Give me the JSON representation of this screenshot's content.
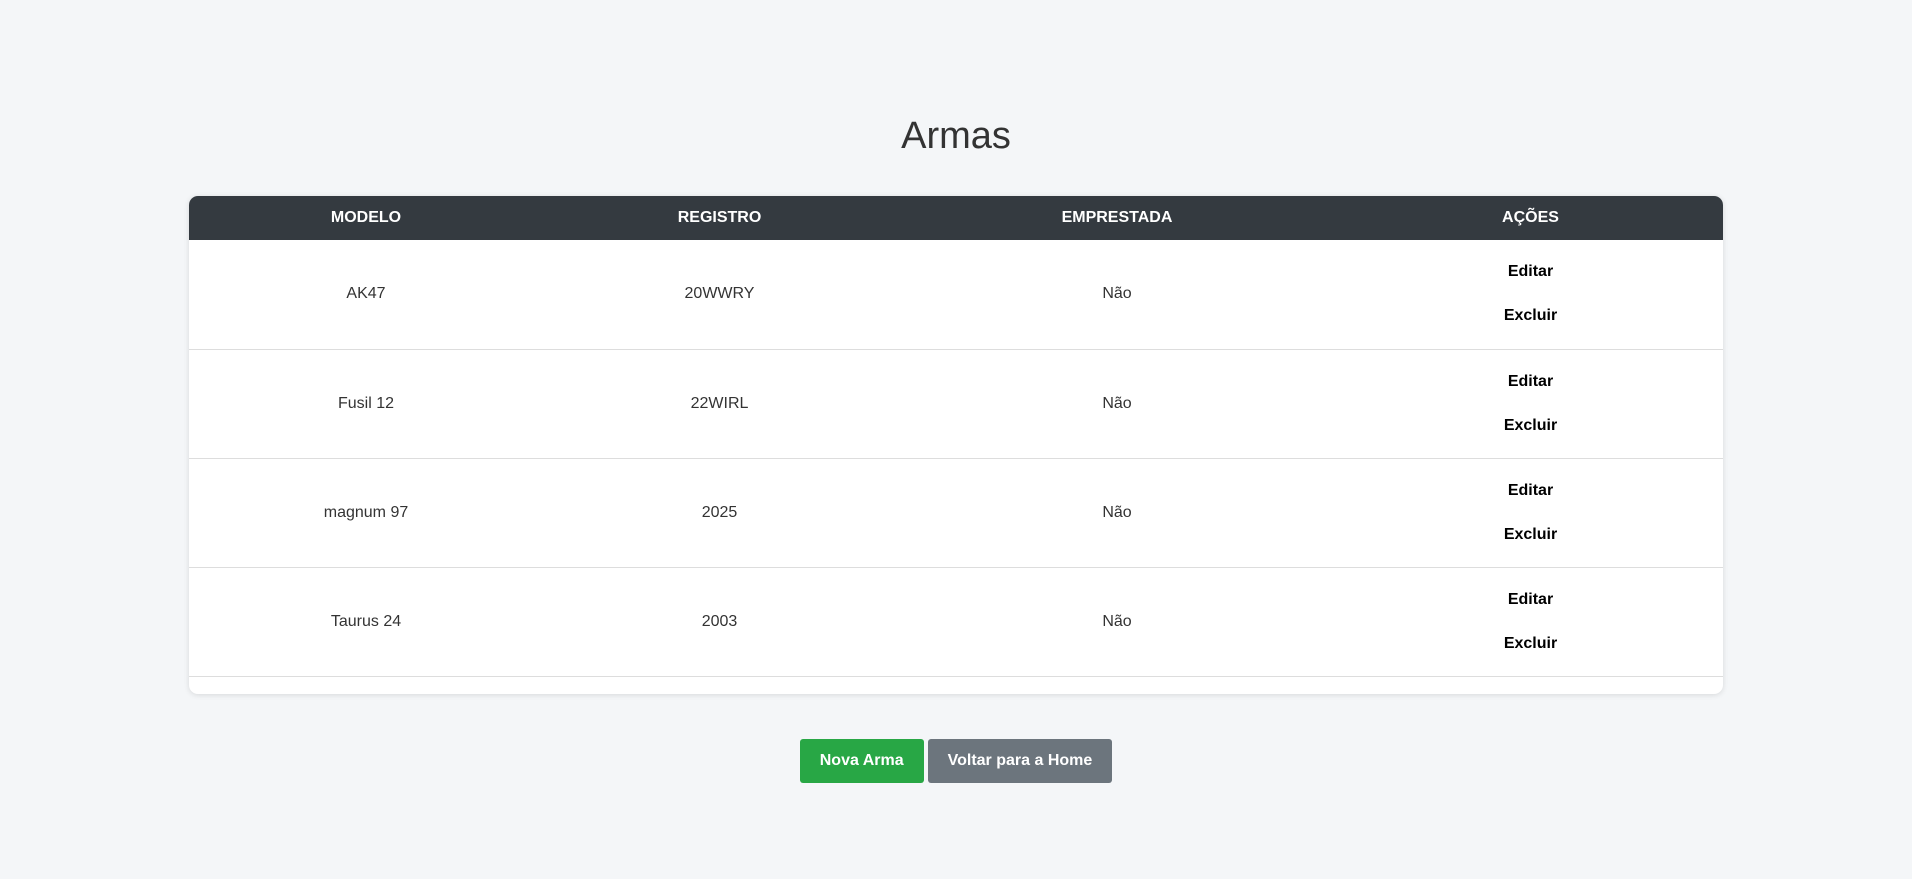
{
  "page": {
    "title": "Armas"
  },
  "table": {
    "headers": {
      "modelo": "MODELO",
      "registro": "REGISTRO",
      "emprestada": "EMPRESTADA",
      "acoes": "AÇÕES"
    },
    "rows": [
      {
        "modelo": "AK47",
        "registro": "20WWRY",
        "emprestada": "Não",
        "edit_label": "Editar",
        "delete_label": "Excluir"
      },
      {
        "modelo": "Fusil 12",
        "registro": "22WIRL",
        "emprestada": "Não",
        "edit_label": "Editar",
        "delete_label": "Excluir"
      },
      {
        "modelo": "magnum 97",
        "registro": "2025",
        "emprestada": "Não",
        "edit_label": "Editar",
        "delete_label": "Excluir"
      },
      {
        "modelo": "Taurus 24",
        "registro": "2003",
        "emprestada": "Não",
        "edit_label": "Editar",
        "delete_label": "Excluir"
      }
    ]
  },
  "actions": {
    "new_label": "Nova Arma",
    "home_label": "Voltar para a Home"
  },
  "colors": {
    "background": "#f4f6f8",
    "header": "#343a40",
    "primary_button": "#28a745",
    "secondary_button": "#6c757d"
  }
}
